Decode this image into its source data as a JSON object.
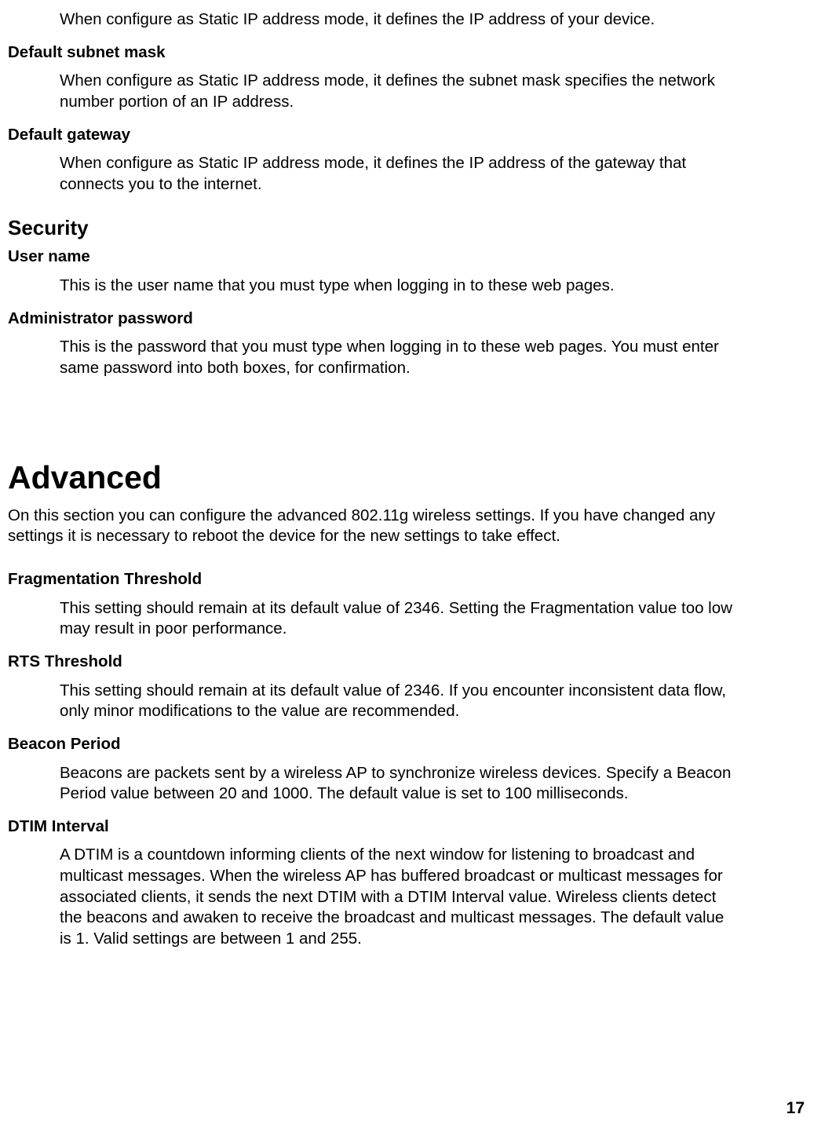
{
  "topSection": {
    "ipAddressDesc": "When configure as Static IP address mode, it defines the IP address of your device.",
    "subnetMask": {
      "term": "Default subnet mask",
      "desc": "When configure as Static IP address mode, it defines the subnet mask specifies the network number portion of an IP address."
    },
    "gateway": {
      "term": "Default gateway",
      "desc": "When configure as Static IP address mode, it defines the IP address of the gateway that connects you to the internet."
    }
  },
  "security": {
    "heading": "Security",
    "userName": {
      "term": "User name",
      "desc": "This is the user name that you must type when logging in to these web pages."
    },
    "adminPassword": {
      "term": "Administrator password",
      "desc": "This is the password that you must type when logging in to these web pages. You must enter same password into both boxes, for confirmation."
    }
  },
  "advanced": {
    "heading": "Advanced",
    "intro": "On this section you can configure the advanced 802.11g wireless settings. If you have changed any settings it is necessary to reboot the device for the new settings to take effect.",
    "frag": {
      "term": "Fragmentation Threshold",
      "desc": "This setting should remain at its default value of 2346. Setting the Fragmentation value too low may result in poor performance."
    },
    "rts": {
      "term": "RTS Threshold",
      "desc": "This setting should remain at its default value of 2346. If you encounter inconsistent data flow, only minor modifications to the value are recommended."
    },
    "beacon": {
      "term": "Beacon Period",
      "desc": "Beacons are packets sent by a wireless AP to synchronize wireless devices. Specify a Beacon Period value between 20 and 1000. The default value is set to 100 milliseconds."
    },
    "dtim": {
      "term": "DTIM Interval",
      "desc": "A DTIM is a countdown informing clients of the next window for listening to broadcast and multicast messages. When the wireless AP has buffered broadcast or multicast messages for associated clients, it sends the next DTIM with a DTIM Interval value. Wireless clients detect the beacons and awaken to receive the broadcast and multicast messages. The default value is 1. Valid settings are between 1 and 255."
    }
  },
  "pageNumber": "17"
}
